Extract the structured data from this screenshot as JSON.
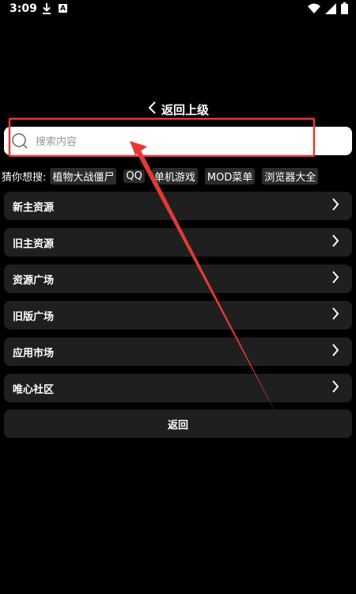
{
  "status_bar": {
    "time": "3:09",
    "download_icon": "download-icon",
    "a_badge": "A"
  },
  "header": {
    "back_label": "返回上级"
  },
  "search": {
    "placeholder": "搜索内容"
  },
  "suggestions": {
    "label": "猜你想搜:",
    "chips": [
      "植物大战僵尸",
      "QQ",
      "单机游戏",
      "MOD菜单",
      "浏览器大全"
    ]
  },
  "menu": {
    "items": [
      {
        "label": "新主资源"
      },
      {
        "label": "旧主资源"
      },
      {
        "label": "资源广场"
      },
      {
        "label": "旧版广场"
      },
      {
        "label": "应用市场"
      },
      {
        "label": "唯心社区"
      }
    ],
    "back_label": "返回"
  },
  "colors": {
    "background": "#000000",
    "card": "#1f1f1f",
    "chip": "#2b2b2b",
    "annotation": "#e53935"
  }
}
